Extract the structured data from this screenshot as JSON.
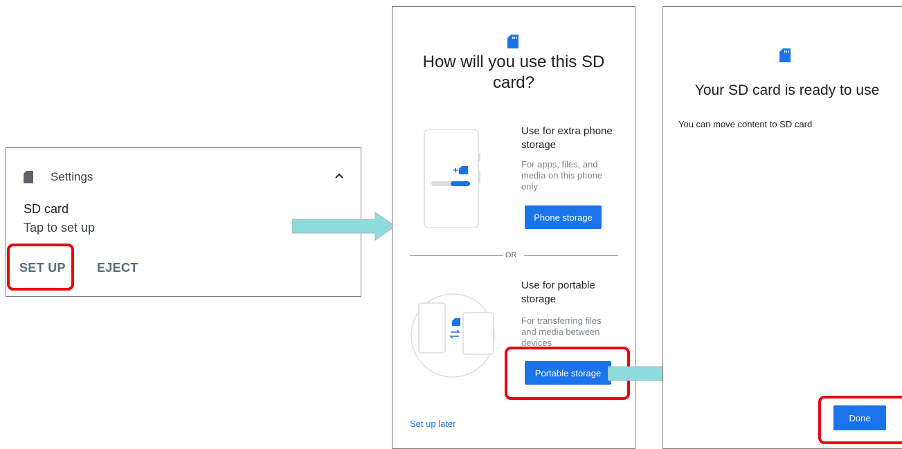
{
  "notification": {
    "app_name": "Settings",
    "title": "SD card",
    "text": "Tap to set up",
    "actions": [
      "SET UP",
      "EJECT"
    ]
  },
  "setup_screen": {
    "title_line1": "How will you use this SD",
    "title_line2": "card?",
    "option_phone": {
      "title": "Use for extra phone storage",
      "desc": "For apps, files, and media on this phone only",
      "button": "Phone storage"
    },
    "divider": "OR",
    "option_portable": {
      "title": "Use for portable storage",
      "desc": "For transferring files and media between devices",
      "button": "Portable storage"
    },
    "later_link": "Set up later"
  },
  "ready_screen": {
    "title": "Your SD card is ready to use",
    "text": "You can move content to SD card",
    "button": "Done"
  },
  "icons": [
    "sd-card-icon",
    "chevron-up-icon",
    "arrow-right-icon"
  ],
  "colors": {
    "accent": "#1a73e8",
    "highlight": "#e8050f",
    "arrow": "#8fdcdc",
    "action_text": "#546e7a"
  }
}
